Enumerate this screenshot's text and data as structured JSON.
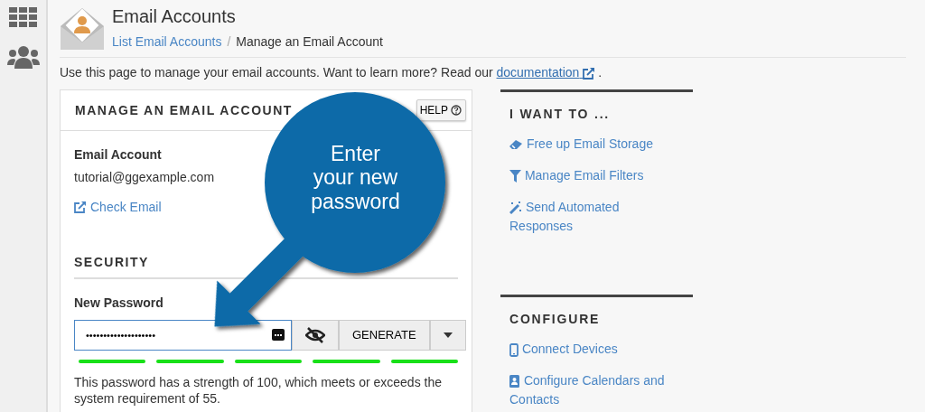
{
  "header": {
    "title": "Email Accounts",
    "separator": "/",
    "breadcrumb": [
      {
        "label": "List Email Accounts",
        "link": true
      },
      {
        "label": "Manage an Email Account",
        "link": false
      }
    ]
  },
  "intro": {
    "text": "Use this page to manage your email accounts. Want to learn more? Read our",
    "link": "documentation",
    "suffix": "."
  },
  "card": {
    "title": "MANAGE AN EMAIL ACCOUNT",
    "help_button": "HELP",
    "account_label": "Email Account",
    "account_value": "tutorial@ggexample.com",
    "check_email_link": "Check Email",
    "security_heading": "SECURITY",
    "password_label": "New Password",
    "password_value": "••••••••••••••••••••",
    "generate_button": "GENERATE",
    "strength_segments": [
      {
        "on": true
      },
      {
        "on": true
      },
      {
        "on": true
      },
      {
        "on": true
      },
      {
        "on": true
      }
    ],
    "strength_text": "This password has a strength of 100, which meets or exceeds the system requirement of 55."
  },
  "side_sections": [
    {
      "title": "I WANT TO ...",
      "links": [
        "Free up Email Storage",
        "Manage Email Filters",
        "Send Automated Responses"
      ]
    },
    {
      "title": "CONFIGURE",
      "links": [
        "Connect Devices",
        "Configure Calendars and Contacts"
      ]
    }
  ],
  "callout": {
    "text": "Enter\nyour new\npassword"
  }
}
